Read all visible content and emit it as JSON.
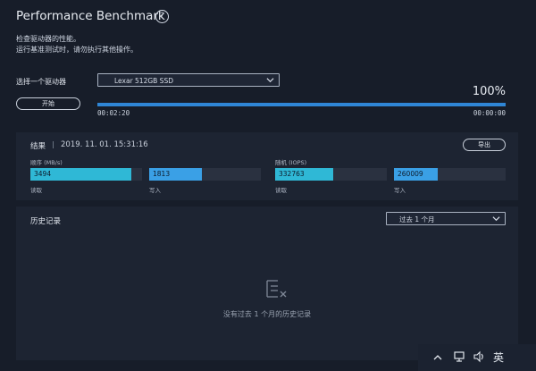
{
  "header": {
    "title": "Performance Benchmark",
    "help_icon": "?"
  },
  "description": {
    "line1": "检查驱动器的性能。",
    "line2": "运行基准测试时，请勿执行其他操作。"
  },
  "drive": {
    "label": "选择一个驱动器",
    "selected": "Lexar 512GB SSD"
  },
  "start_button": "开始",
  "progress": {
    "percent_text": "100%",
    "value": 1.0,
    "elapsed": "00:02:20",
    "remaining": "00:00:00"
  },
  "results": {
    "label": "结果",
    "separator": "|",
    "timestamp": "2019. 11. 01. 15:31:16",
    "export_button": "导出",
    "sequential": {
      "label": "顺序 (MB/s)",
      "read_value": "3494",
      "read_caption": "读取",
      "write_value": "1813",
      "write_caption": "写入",
      "read_fill": 0.9,
      "write_fill": 0.47
    },
    "random": {
      "label": "随机 (IOPS)",
      "read_value": "332763",
      "read_caption": "读取",
      "write_value": "260009",
      "write_caption": "写入",
      "read_fill": 0.52,
      "write_fill": 0.39
    }
  },
  "history": {
    "label": "历史记录",
    "range_selected": "过去 1 个月",
    "empty_text": "没有过去 1 个月的历史记录"
  },
  "colors": {
    "background": "#171d29",
    "panel": "#1d2432",
    "accent_blue": "#2f86d6",
    "cyan": "#2fb8d6",
    "light_blue": "#3aa0e6"
  },
  "taskbar": {
    "icons": [
      "tray-up-icon",
      "network-icon",
      "volume-icon",
      "ime-icon"
    ],
    "ime_label": "英"
  }
}
